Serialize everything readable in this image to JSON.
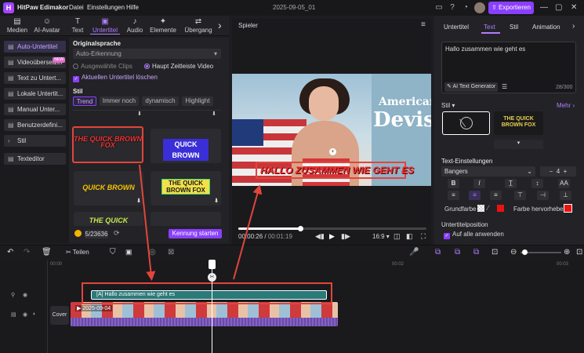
{
  "titlebar": {
    "app_name": "HitPaw Edimakor",
    "menu": [
      "Datei",
      "Einstellungen",
      "Hilfe"
    ],
    "project": "2025-09-05_01",
    "export_label": "Exportieren"
  },
  "toolbar": {
    "items": [
      {
        "label": "Medien",
        "icon": "folder-icon"
      },
      {
        "label": "AI-Avatar",
        "icon": "avatar-icon"
      },
      {
        "label": "Text",
        "icon": "text-icon"
      },
      {
        "label": "Untertitel",
        "icon": "subtitle-icon"
      },
      {
        "label": "Audio",
        "icon": "music-icon"
      },
      {
        "label": "Elemente",
        "icon": "elements-icon"
      },
      {
        "label": "Übergang",
        "icon": "transition-icon"
      }
    ],
    "more": "›"
  },
  "sidebar": {
    "items": [
      {
        "label": "Auto-Untertitel"
      },
      {
        "label": "Videoübersetzer",
        "badge": "NEW"
      },
      {
        "label": "Text zu Untert..."
      },
      {
        "label": "Lokale Untertit..."
      },
      {
        "label": "Manual Unter..."
      },
      {
        "label": "Benutzerdefini..."
      },
      {
        "label": "Stil"
      },
      {
        "label": "Texteditor"
      }
    ]
  },
  "settings": {
    "lang_title": "Originalsprache",
    "lang_value": "Auto-Erkennung",
    "radio_selected": "Ausgewählte Clips",
    "radio_main": "Haupt Zeitleiste Video",
    "delete_label": "Aktuellen Untertitel löschen",
    "style_title": "Stil",
    "style_tabs": [
      "Trend",
      "Immer noch",
      "dynamisch",
      "Highlight"
    ],
    "cards": [
      "THE QUICK BROWN FOX",
      "QUICK BROWN",
      "QUICK BROWN",
      "THE QUICK BROWN FOX",
      "THE QUICK"
    ],
    "credits": "5/23636",
    "start_label": "Kennung starten"
  },
  "player": {
    "title": "Spieler",
    "subtitle_text": "HALLO ZUSAMMEN WIE GEHT ES",
    "sign_line1": "American",
    "sign_line2": "Devis",
    "time_current": "00:00:26",
    "time_total": "00:01:19",
    "ratio": "16:9",
    "progress": 0.33
  },
  "right": {
    "tabs": [
      "Untertitel",
      "Text",
      "Stil",
      "Animation"
    ],
    "text_value": "Hallo zusammen  wie geht es",
    "ai_label": "AI Text Generator",
    "counter": "28/300",
    "style_label": "Stil",
    "more_label": "Mehr",
    "preset_card": "THE QUICK BROWN FOX",
    "text_settings": "Text-Einstellungen",
    "font": "Bangers",
    "size": "4",
    "fill_label": "Grundfarbe",
    "highlight_label": "Farbe hervorheben",
    "position_label": "Untertitelposition",
    "apply_all": "Auf alle anwenden"
  },
  "timeline": {
    "split_label": "Teilen",
    "tick_0": "00:00",
    "tick_1": "00:02",
    "tick_2": "00:03",
    "subtitle_clip": "Hallo zusammen  wie geht es",
    "video_clip": "2025-09-04",
    "cover_label": "Cover"
  },
  "colors": {
    "accent": "#8a3ffc",
    "subtitle_track": "#2a7a7a",
    "video_track": "#6b4aa8",
    "annotation": "#e2453b"
  }
}
